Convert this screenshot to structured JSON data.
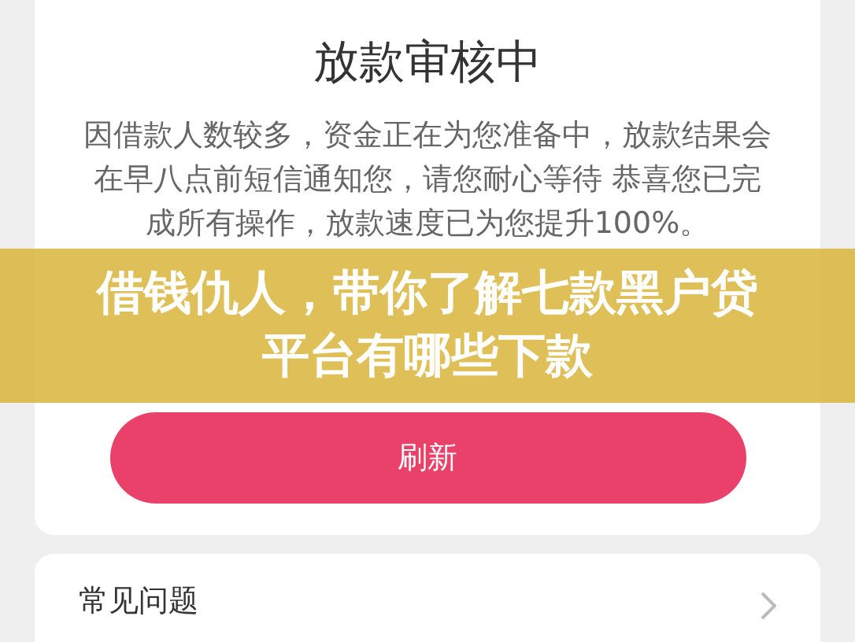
{
  "status_card": {
    "title": "放款审核中",
    "message": "因借款人数较多，资金正在为您准备中，放款结果会在早八点前短信通知您，请您耐心等待 恭喜您已完成所有操作，放款速度已为您提升100%。",
    "button": "刷新"
  },
  "faq": {
    "label": "常见问题"
  },
  "overlay_title": "借钱仇人，带你了解七款黑户贷平台有哪些下款"
}
